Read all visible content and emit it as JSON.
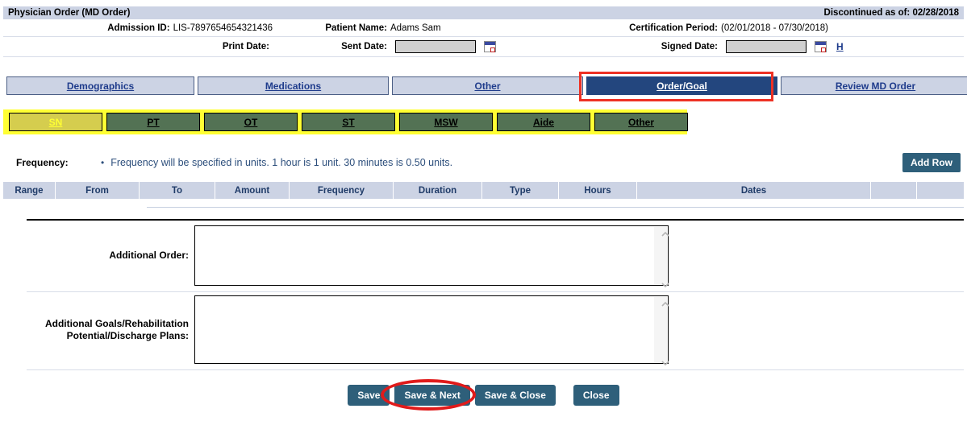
{
  "form": {
    "title": "Physician Order (MD Order)",
    "status": "Discontinued as of: 02/28/2018",
    "fields": {
      "admission_id_label": "Admission ID:",
      "admission_id_value": "LIS-7897654654321436",
      "patient_name_label": "Patient Name:",
      "patient_name_value": "Adams Sam",
      "certification_period_label": "Certification Period:",
      "certification_period_value": "(02/01/2018 - 07/30/2018)",
      "print_date_label": "Print Date:",
      "print_date_value": "",
      "sent_date_label": "Sent Date:",
      "sent_date_value": "",
      "signed_date_label": "Signed Date:",
      "signed_date_value": "",
      "history_link": "H"
    }
  },
  "nav_tabs": [
    {
      "label": "Demographics",
      "active": false
    },
    {
      "label": "Medications",
      "active": false
    },
    {
      "label": "Other",
      "active": false
    },
    {
      "label": "Order/Goal",
      "active": true
    },
    {
      "label": "Review MD Order",
      "active": false
    }
  ],
  "discipline_tabs": [
    {
      "label": "SN",
      "selected": true
    },
    {
      "label": "PT",
      "selected": false
    },
    {
      "label": "OT",
      "selected": false
    },
    {
      "label": "ST",
      "selected": false
    },
    {
      "label": "MSW",
      "selected": false
    },
    {
      "label": "Aide",
      "selected": false
    },
    {
      "label": "Other",
      "selected": false
    }
  ],
  "frequency": {
    "label": "Frequency:",
    "bullet": "•",
    "note": "Frequency will be specified in units. 1 hour is 1 unit. 30 minutes is 0.50 units.",
    "add_row_label": "Add Row"
  },
  "grid": {
    "columns": [
      "Range",
      "From",
      "To",
      "Amount",
      "Frequency",
      "Duration",
      "Type",
      "Hours",
      "Dates",
      "",
      ""
    ],
    "rows": []
  },
  "textareas": [
    {
      "label": "Additional Order:",
      "value": "",
      "placeholder": ""
    },
    {
      "label": "Additional Goals/Rehabilitation Potential/Discharge Plans:",
      "value": "",
      "placeholder": ""
    }
  ],
  "footer_buttons": [
    {
      "label": "Save",
      "highlighted": false
    },
    {
      "label": "Save & Next",
      "highlighted": true
    },
    {
      "label": "Save & Close",
      "highlighted": false
    },
    {
      "label": "Close",
      "highlighted": false
    }
  ],
  "colors": {
    "header_band": "#ccd3e4",
    "active_tab": "#23467e",
    "discipline_green": "#537254",
    "discipline_selected": "#d5cd4e",
    "highlight_yellow": "#ffff33",
    "annotation_red": "#ee3124",
    "button_blue": "#2e5f7a",
    "link_blue": "#1f3c8c",
    "grid_header_text": "#1f3b68"
  }
}
